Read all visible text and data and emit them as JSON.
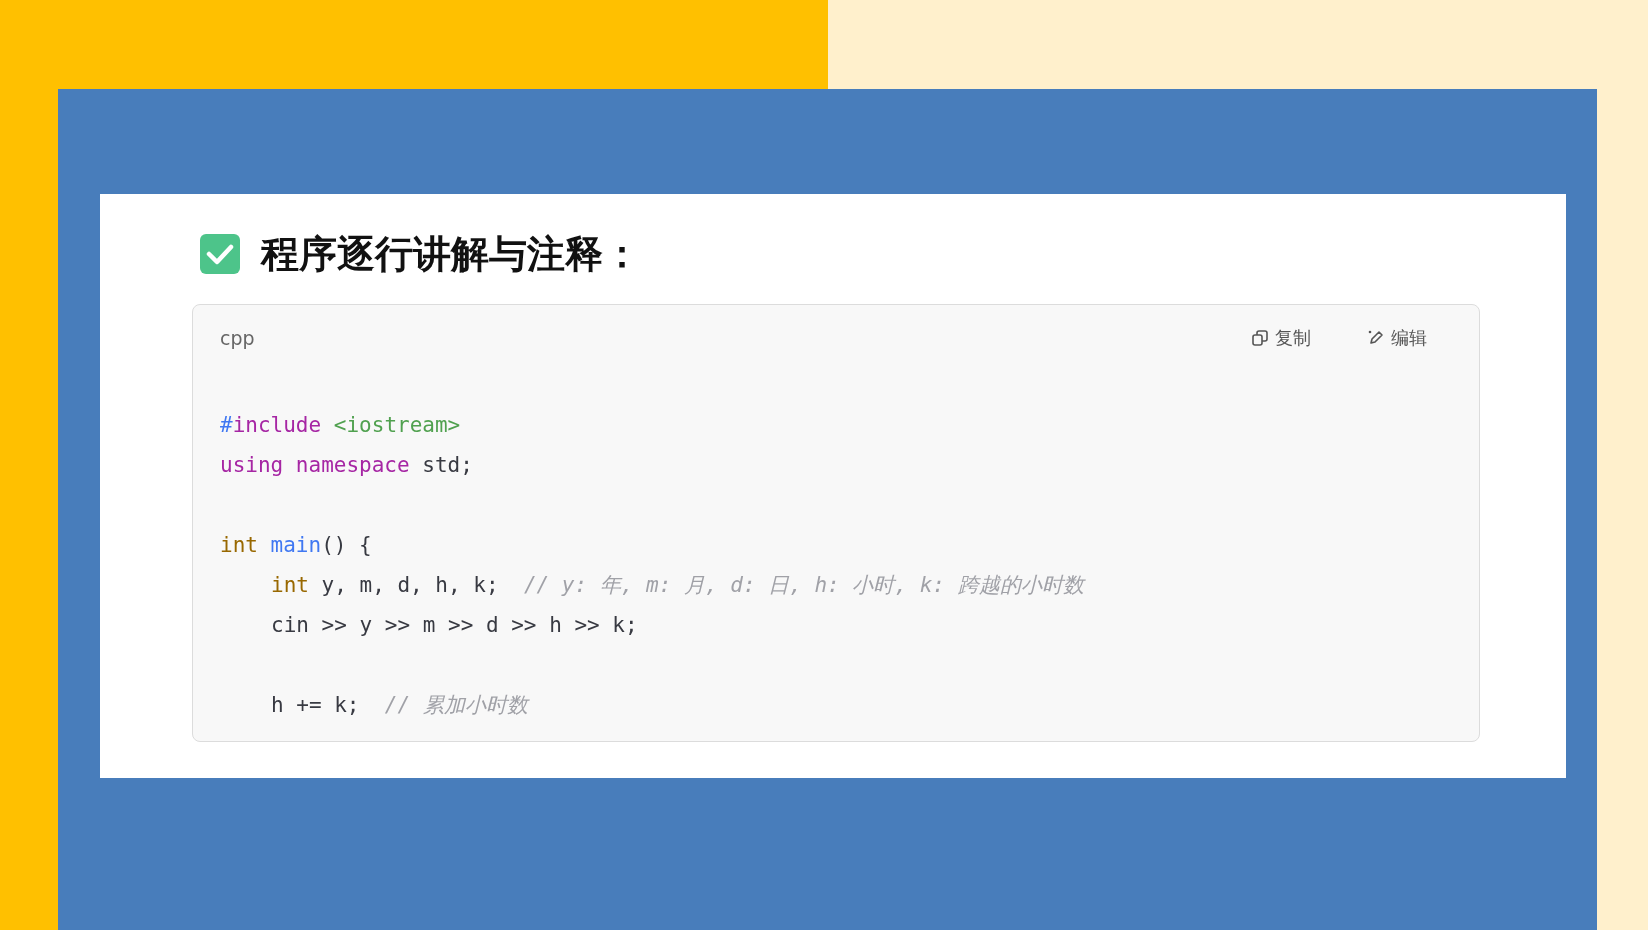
{
  "heading": {
    "text": "程序逐行讲解与注释："
  },
  "code_block": {
    "language": "cpp",
    "actions": [
      {
        "kind": "copy",
        "label": "复制"
      },
      {
        "kind": "edit",
        "label": "编辑"
      }
    ],
    "lines": [
      {
        "kind": "code",
        "tokens": [
          {
            "kind": "hash",
            "text": "#"
          },
          {
            "kind": "keyword",
            "text": "include "
          },
          {
            "kind": "string",
            "text": "<iostream>"
          }
        ]
      },
      {
        "kind": "code",
        "tokens": [
          {
            "kind": "keyword",
            "text": "using namespace "
          },
          {
            "kind": "plain",
            "text": "std;"
          }
        ]
      },
      {
        "kind": "blank"
      },
      {
        "kind": "code",
        "tokens": [
          {
            "kind": "type",
            "text": "int "
          },
          {
            "kind": "function",
            "text": "main"
          },
          {
            "kind": "plain",
            "text": "() {"
          }
        ],
        "children": [
          {
            "kind": "code",
            "tokens": [
              {
                "kind": "type",
                "text": "int "
              },
              {
                "kind": "plain",
                "text": "y, m, d, h, k;  "
              },
              {
                "kind": "comment",
                "text": "// y: 年, m: 月, d: 日, h: 小时, k: 跨越的小时数"
              }
            ]
          },
          {
            "kind": "code",
            "tokens": [
              {
                "kind": "plain",
                "text": "cin >> y >> m >> d >> h >> k;"
              }
            ]
          },
          {
            "kind": "blank"
          },
          {
            "kind": "code",
            "tokens": [
              {
                "kind": "plain",
                "text": "h += k;  "
              },
              {
                "kind": "comment",
                "text": "// 累加小时数"
              }
            ]
          }
        ]
      }
    ]
  }
}
